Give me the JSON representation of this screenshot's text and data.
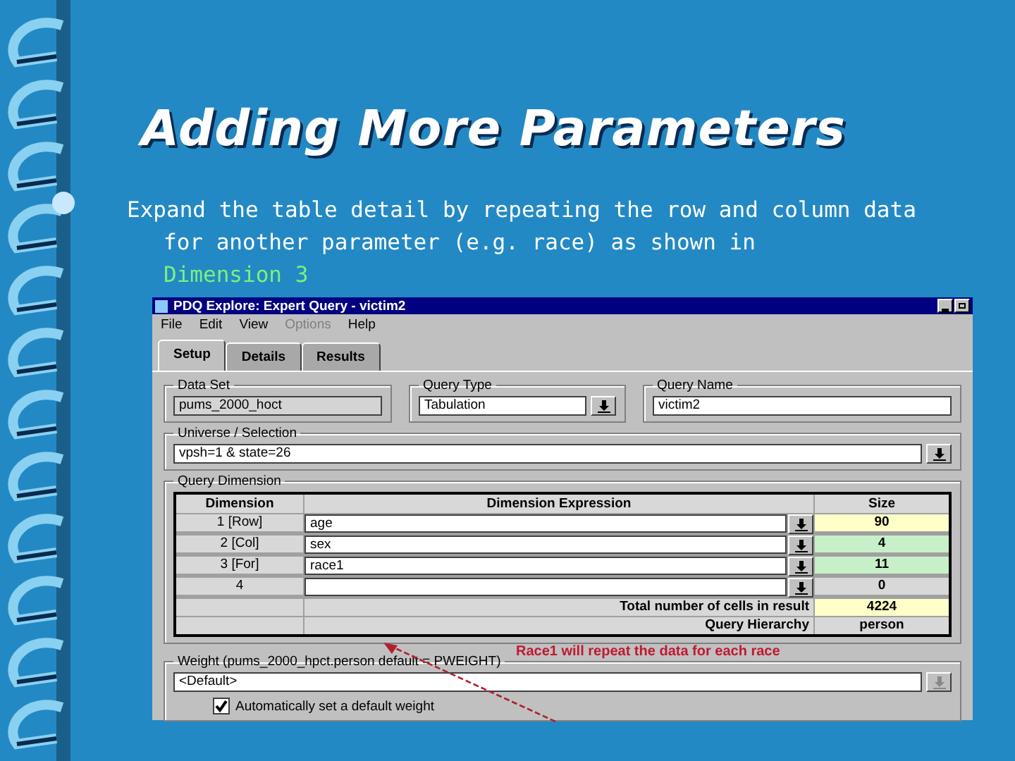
{
  "slide": {
    "title": "Adding More Parameters",
    "body": "Expand the table detail by repeating the row and column data for another parameter (e.g. race) as shown in",
    "body_link": "Dimension 3"
  },
  "window": {
    "title": "PDQ Explore: Expert Query - victim2",
    "menu": [
      {
        "label": "File",
        "disabled": false
      },
      {
        "label": "Edit",
        "disabled": false
      },
      {
        "label": "View",
        "disabled": false
      },
      {
        "label": "Options",
        "disabled": true
      },
      {
        "label": "Help",
        "disabled": false
      }
    ],
    "tabs": [
      {
        "label": "Setup",
        "selected": true
      },
      {
        "label": "Details",
        "selected": false
      },
      {
        "label": "Results",
        "selected": false
      }
    ],
    "data_set": {
      "label": "Data Set",
      "value": "pums_2000_hoct"
    },
    "query_type": {
      "label": "Query Type",
      "value": "Tabulation"
    },
    "query_name": {
      "label": "Query Name",
      "value": "victim2"
    },
    "universe": {
      "label": "Universe / Selection",
      "value": "vpsh=1 & state=26"
    },
    "dimension": {
      "label": "Query Dimension",
      "columns": [
        "Dimension",
        "Dimension Expression",
        "Size"
      ],
      "rows": [
        {
          "dimension": "1 [Row]",
          "expression": "age",
          "size": "90",
          "color": "#ffffc8"
        },
        {
          "dimension": "2 [Col]",
          "expression": "sex",
          "size": "4",
          "color": "#c8f0c8"
        },
        {
          "dimension": "3 [For]",
          "expression": "race1",
          "size": "11",
          "color": "#c8f0c8"
        },
        {
          "dimension": "4",
          "expression": "",
          "size": "0",
          "color": "#d8d8d8"
        }
      ],
      "summary": [
        {
          "label": "Total number of cells in result",
          "value": "4224",
          "color": "#ffffc8"
        },
        {
          "label": "Query Hierarchy",
          "value": "person",
          "color": "#d8d8d8"
        }
      ]
    },
    "annotation": "Race1 will repeat the data for each race",
    "weight": {
      "label": "Weight (pums_2000_hpct.person default = PWEIGHT)",
      "value": "<Default>",
      "auto": {
        "label": "Automatically set a default weight",
        "checked": true
      }
    }
  }
}
